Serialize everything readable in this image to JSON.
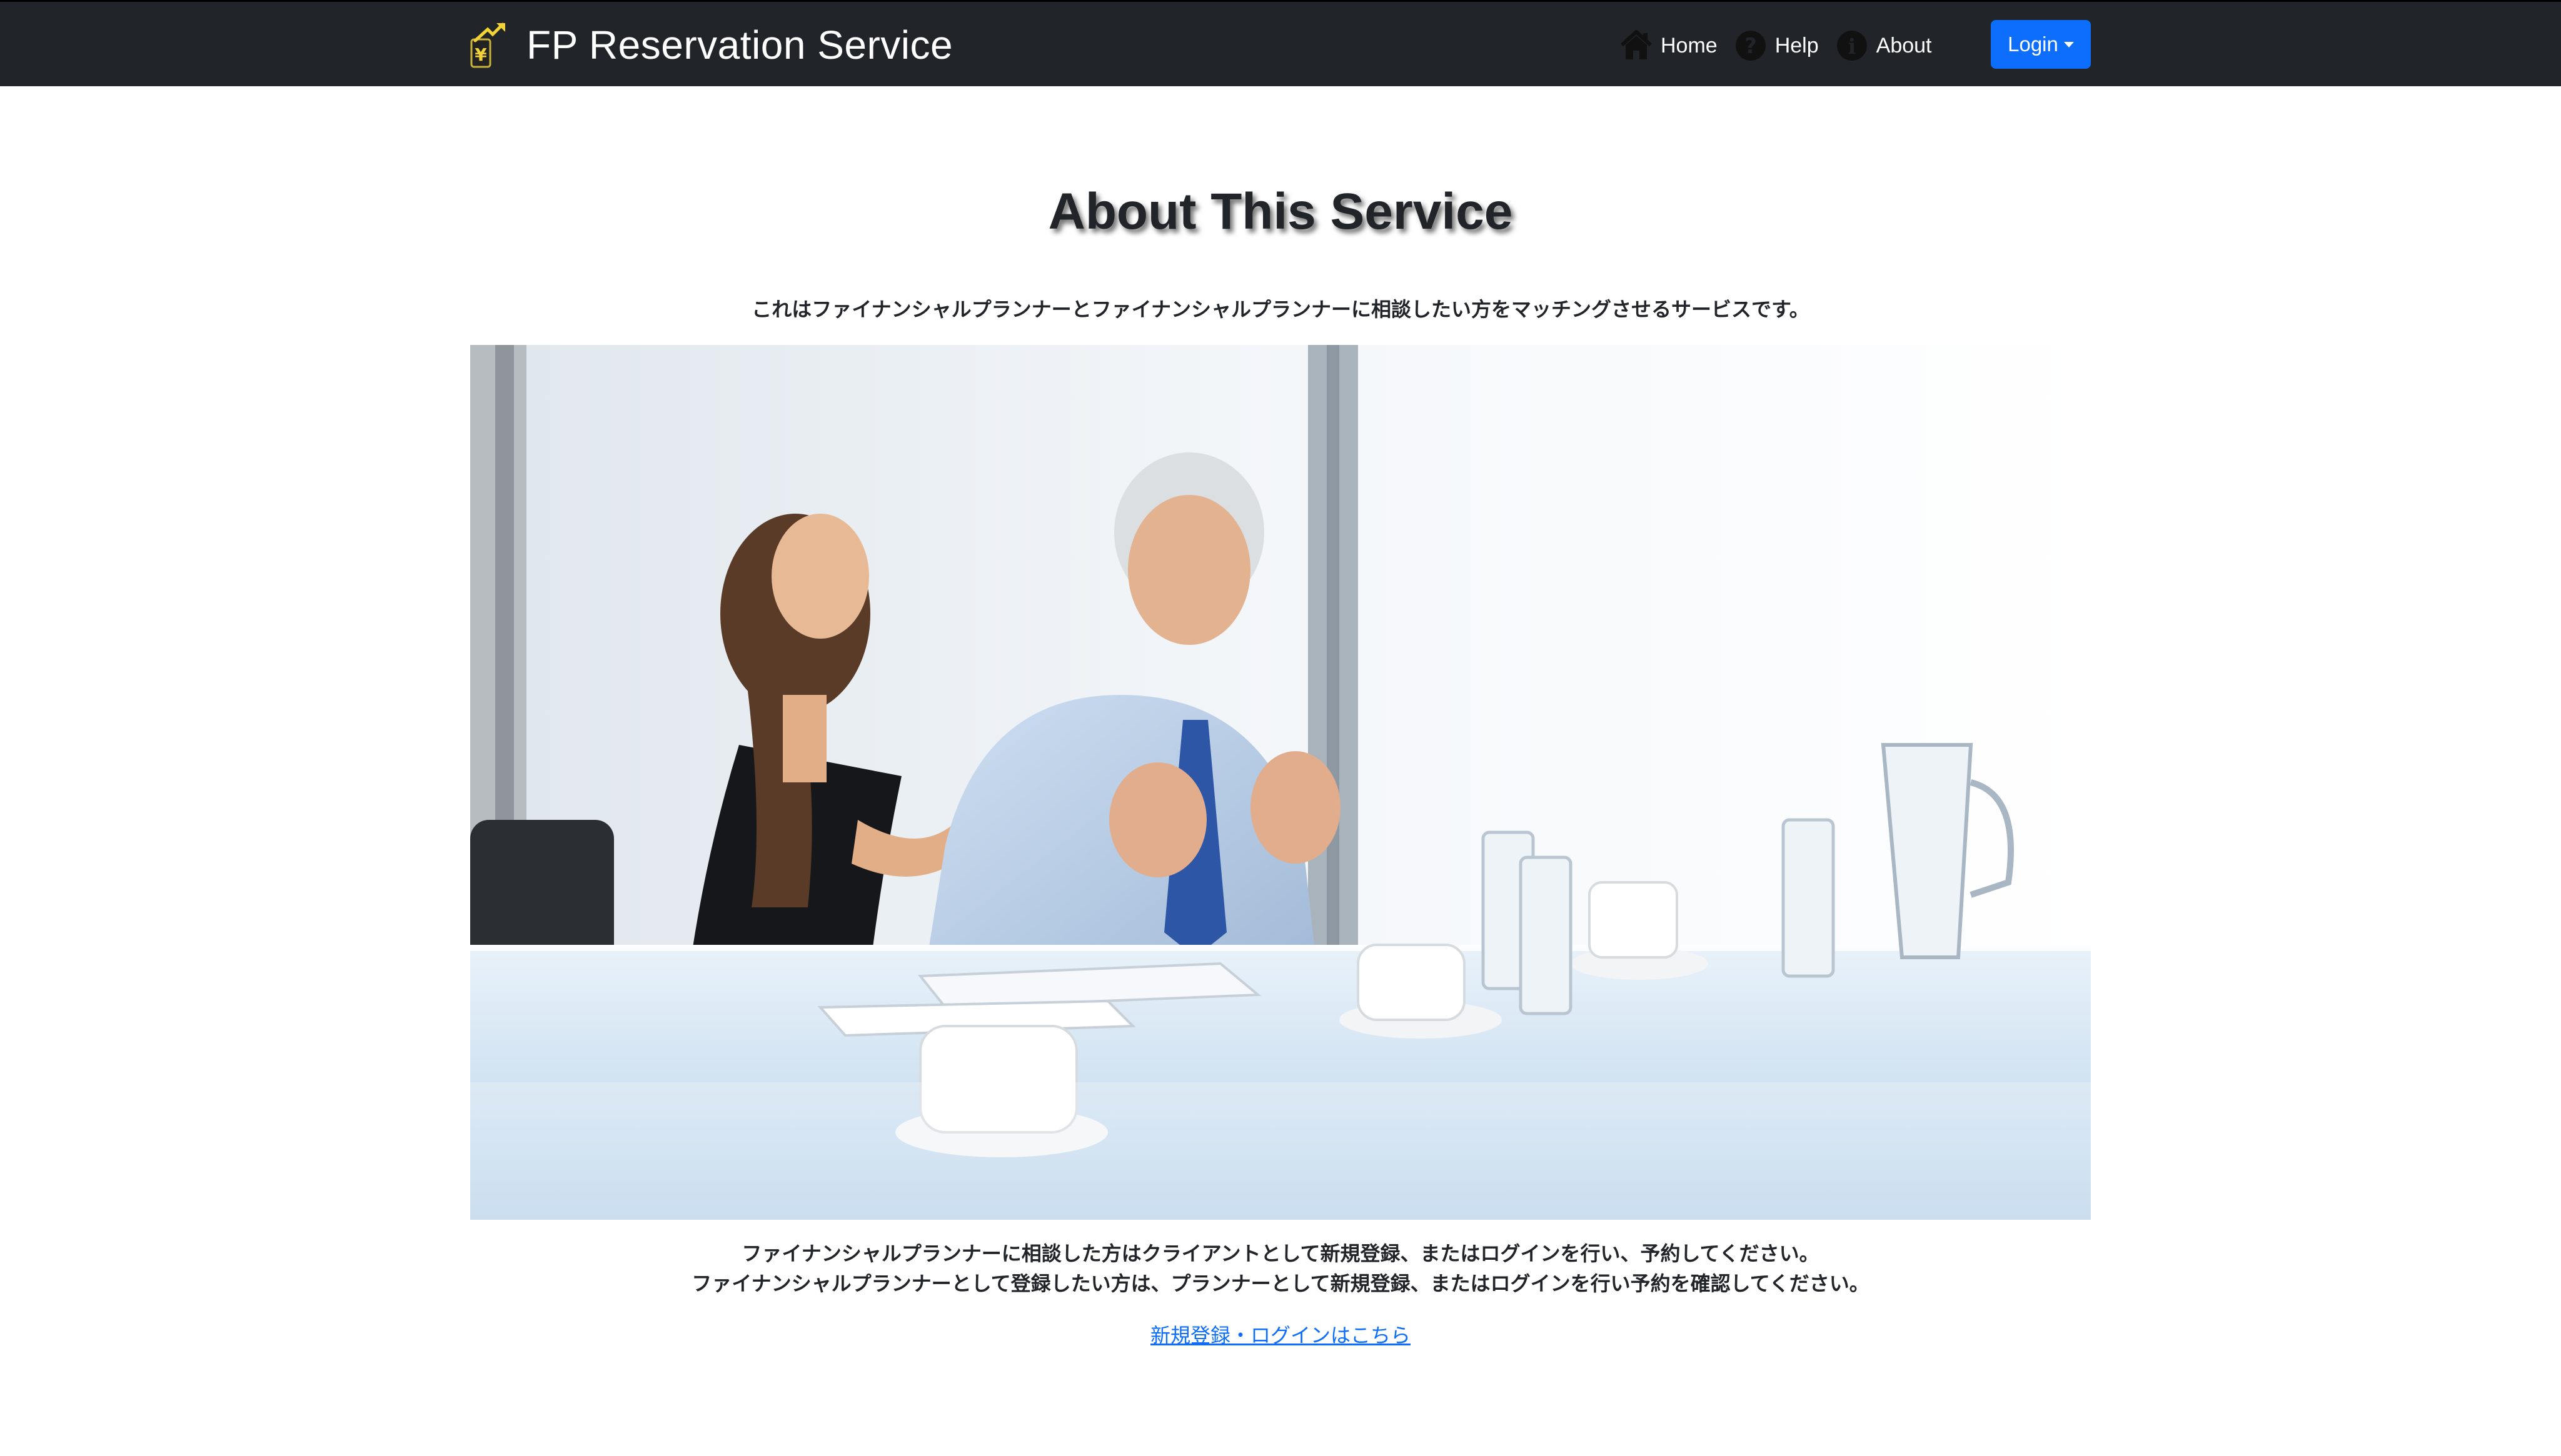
{
  "navbar": {
    "brand_title": "FP Reservation Service",
    "logo_icon": "yen-growth-logo-icon",
    "links": [
      {
        "label": "Home",
        "icon": "home-icon"
      },
      {
        "label": "Help",
        "icon": "question-circle-icon"
      },
      {
        "label": "About",
        "icon": "info-circle-icon"
      }
    ],
    "login_label": "Login"
  },
  "main": {
    "title": "About This Service",
    "intro": "これはファイナンシャルプランナーとファイナンシャルプランナーに相談したい方をマッチングさせるサービスです。",
    "description_line1": "ファイナンシャルプランナーに相談した方はクライアントとして新規登録、またはログインを行い、予約してください。",
    "description_line2": "ファイナンシャルプランナーとして登録したい方は、プランナーとして新規登録、またはログインを行い予約を確認してください。",
    "register_link": "新規登録・ログインはこちら"
  },
  "colors": {
    "navbar_bg": "#212529",
    "primary": "#0d6efd",
    "text": "#212529"
  }
}
